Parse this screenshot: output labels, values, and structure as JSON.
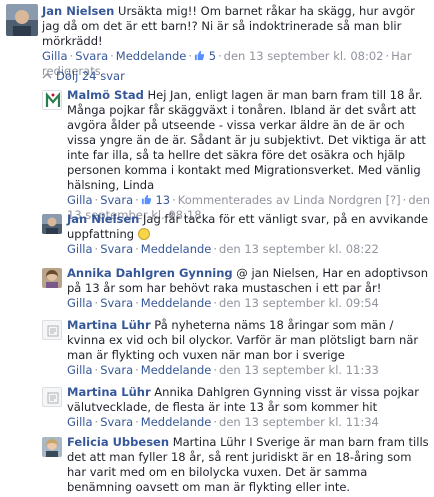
{
  "root": {
    "author": "Jan Nielsen",
    "text": "Ursäkta mig!! Om barnet råkar ha skägg, hur avgör jag då om det är ett barn!? Ni är så indoktrinerade så man blir mörkrädd!",
    "actions": {
      "like": "Gilla",
      "reply": "Svara",
      "message": "Meddelande"
    },
    "likes": "5",
    "timestamp": "den 13 september kl. 08:02",
    "edited": "Har redigerats"
  },
  "hide_replies": "Dölj 24 svar",
  "replies": [
    {
      "author": "Malmö Stad",
      "text": "Hej Jan, enligt lagen är man barn fram till 18 år. Många pojkar får skäggväxt i tonåren. Ibland är det svårt att avgöra ålder på utseende - vissa verkar äldre än de är och vissa yngre än de är. Sådant är ju subjektivt. Det viktiga är att inte far illa, så ta hellre det säkra före det osäkra och hjälp personen komma i kontakt med Migrationsverket. Med vänlig hälsning, Linda",
      "like": "Gilla",
      "reply": "Svara",
      "likes": "13",
      "extra": "Kommenterades av Linda Nordgren [?]",
      "timestamp": "den 13 september kl. 08:18"
    },
    {
      "author": "Jan Nielsen",
      "text": "Jag får tacka för ett vänligt svar, på en avvikande uppfattning",
      "like": "Gilla",
      "reply": "Svara",
      "message": "Meddelande",
      "timestamp": "den 13 september kl. 08:22"
    },
    {
      "author": "Annika Dahlgren Gynning",
      "text": "@ jan Nielsen, Har en adoptivson på 13 år som har behövt raka mustaschen i ett par år!",
      "like": "Gilla",
      "reply": "Svara",
      "message": "Meddelande",
      "timestamp": "den 13 september kl. 09:54"
    },
    {
      "author": "Martina Lühr",
      "text": "På nyheterna näms 18 åringar som män / kvinna ex vid och bil olyckor. Varför är man plötsligt barn när man är flykting och vuxen när man bor i sverige",
      "like": "Gilla",
      "reply": "Svara",
      "message": "Meddelande",
      "timestamp": "den 13 september kl. 11:33"
    },
    {
      "author": "Martina Lühr",
      "text": "Annika Dahlgren Gynning visst är vissa pojkar välutvecklade, de flesta är inte 13 år som kommer hit",
      "like": "Gilla",
      "reply": "Svara",
      "message": "Meddelande",
      "timestamp": "den 13 september kl. 11:34"
    },
    {
      "author": "Felicia Ubbesen",
      "text": "Martina Lühr I Sverige är man barn fram tills det att man fyller 18 år, så rent juridiskt är en 18-åring som har varit med om en bilolycka vuxen. Det är samma benämning oavsett om man är flykting eller inte."
    }
  ]
}
